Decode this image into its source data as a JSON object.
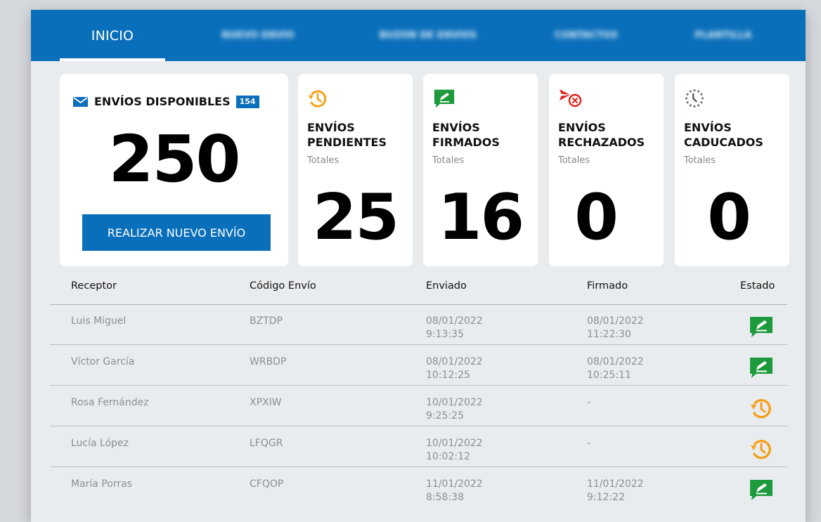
{
  "nav": {
    "tabs": [
      {
        "label": "INICIO",
        "active": true
      },
      {
        "label": "NUEVO ENVÍO",
        "active": false
      },
      {
        "label": "BUZÓN DE ENVÍOS",
        "active": false
      },
      {
        "label": "CONTACTOS",
        "active": false
      },
      {
        "label": "PLANTILLA",
        "active": false
      }
    ]
  },
  "available": {
    "title": "ENVÍOS DISPONIBLES",
    "badge": "154",
    "total": "250",
    "action_label": "REALIZAR NUEVO ENVÍO"
  },
  "stats": [
    {
      "title_line1": "ENVÍOS",
      "title_line2": "PENDIENTES",
      "subtitle": "Totales",
      "value": "25",
      "icon": "pending-clock-icon"
    },
    {
      "title_line1": "ENVÍOS",
      "title_line2": "FIRMADOS",
      "subtitle": "Totales",
      "value": "16",
      "icon": "signed-icon"
    },
    {
      "title_line1": "ENVÍOS",
      "title_line2": "RECHAZADOS",
      "subtitle": "Totales",
      "value": "0",
      "icon": "rejected-icon"
    },
    {
      "title_line1": "ENVÍOS",
      "title_line2": "CADUCADOS",
      "subtitle": "Totales",
      "value": "0",
      "icon": "expired-clock-icon"
    }
  ],
  "table": {
    "headers": [
      "Receptor",
      "Código Envío",
      "Enviado",
      "Firmado",
      "Estado"
    ],
    "rows": [
      {
        "receptor": "Luis Miguel",
        "codigo": "BZTDP",
        "enviado_date": "08/01/2022",
        "enviado_time": "9:13:35",
        "firmado_date": "08/01/2022",
        "firmado_time": "11:22:30",
        "estado": "signed-icon"
      },
      {
        "receptor": "Víctor García",
        "codigo": "WRBDP",
        "enviado_date": "08/01/2022",
        "enviado_time": "10:12:25",
        "firmado_date": "08/01/2022",
        "firmado_time": "10:25:11",
        "estado": "signed-icon"
      },
      {
        "receptor": "Rosa Fernández",
        "codigo": "XPXIW",
        "enviado_date": "10/01/2022",
        "enviado_time": "9:25:25",
        "firmado_date": "-",
        "firmado_time": "",
        "estado": "pending-clock-icon"
      },
      {
        "receptor": "Lucía López",
        "codigo": "LFQGR",
        "enviado_date": "10/01/2022",
        "enviado_time": "10:02:12",
        "firmado_date": "-",
        "firmado_time": "",
        "estado": "pending-clock-icon"
      },
      {
        "receptor": "María Porras",
        "codigo": "CFQOP",
        "enviado_date": "11/01/2022",
        "enviado_time": "8:58:38",
        "firmado_date": "11/01/2022",
        "firmado_time": "9:12:22",
        "estado": "signed-icon"
      }
    ]
  },
  "colors": {
    "brand": "#0a6fba",
    "pending": "#f5a01a",
    "signed": "#1d9a3c",
    "rejected": "#e0201a",
    "expired": "#888888"
  }
}
